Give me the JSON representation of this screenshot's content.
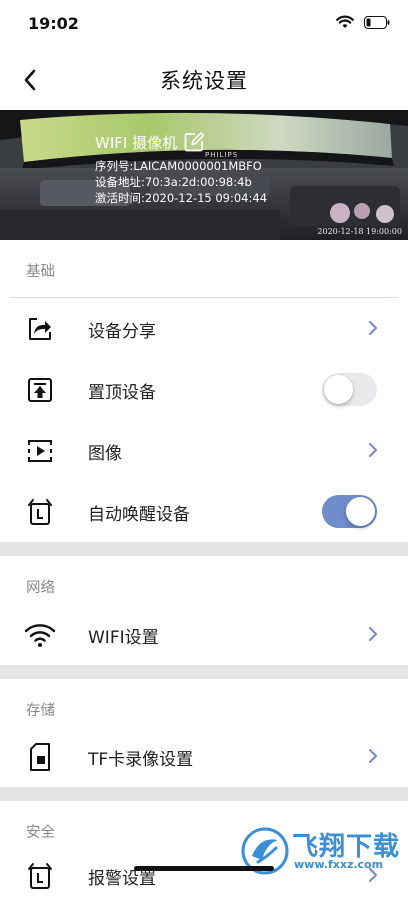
{
  "status_bar": {
    "time": "19:02"
  },
  "nav": {
    "title": "系统设置"
  },
  "device": {
    "name": "WIFI 摄像机",
    "serial": "序列号:LAICAM0000001MBFO",
    "address": "设备地址:70:3a:2d:00:98:4b",
    "activated": "激活时间:2020-12-15 09:04:44",
    "preview_timestamp": "2020-12-18 19:00:00",
    "monitor_brand": "PHILIPS"
  },
  "sections": {
    "basic": {
      "label": "基础",
      "share": {
        "label": "设备分享",
        "icon": "share-icon"
      },
      "pin_top": {
        "label": "置顶设备",
        "icon": "pin-top-icon",
        "toggle_on": false
      },
      "image": {
        "label": "图像",
        "icon": "video-icon"
      },
      "auto_wake": {
        "label": "自动唤醒设备",
        "icon": "alarm-clock-icon",
        "toggle_on": true
      }
    },
    "network": {
      "label": "网络",
      "wifi": {
        "label": "WIFI设置",
        "icon": "wifi-icon"
      }
    },
    "storage": {
      "label": "存储",
      "tf": {
        "label": "TF卡录像设置",
        "icon": "sd-card-icon"
      }
    },
    "security": {
      "label": "安全",
      "alarm": {
        "label": "报警设置",
        "icon": "alarm-clock-icon"
      }
    }
  },
  "watermark": {
    "text": "飞翔下载",
    "url": "www.fxxz.com"
  },
  "colors": {
    "accent": "#6f8ccb",
    "chevron": "#7b8fcb",
    "divider": "#d9daea"
  }
}
